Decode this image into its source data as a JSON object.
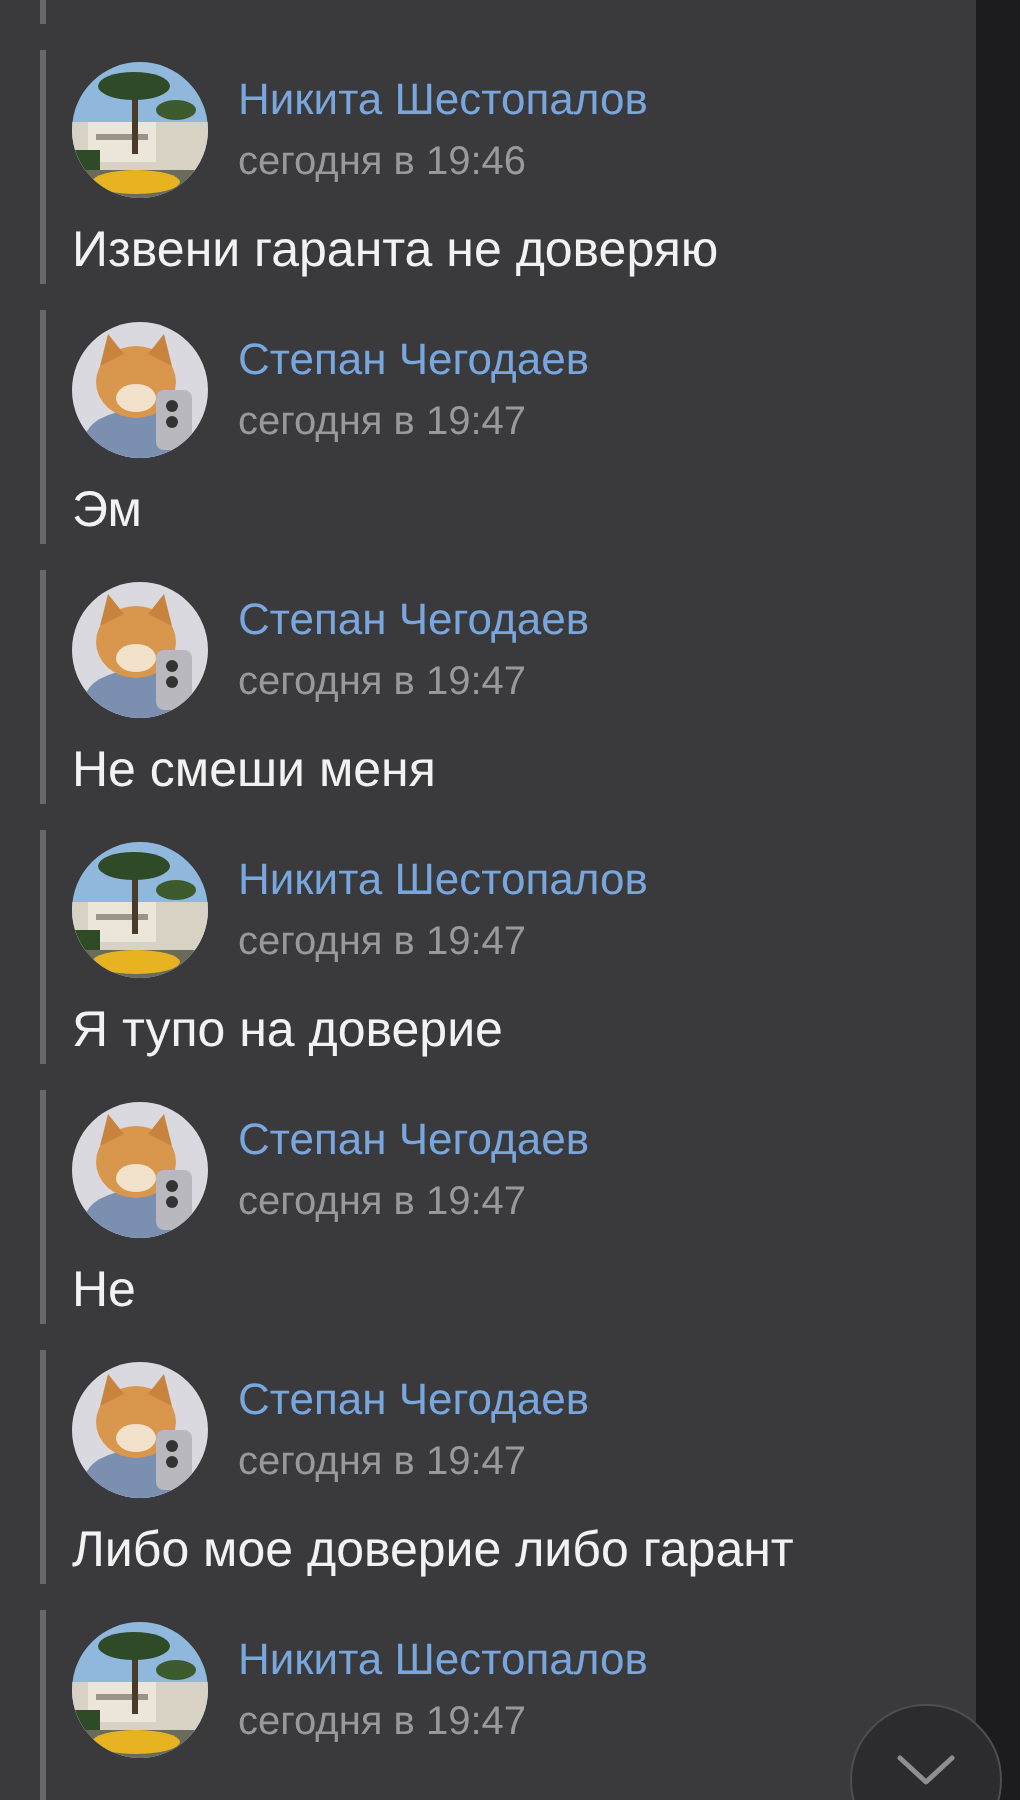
{
  "messages": [
    {
      "author": "Никита Шестопалов",
      "time": "сегодня в 19:46",
      "text": "Извени гаранта не доверяю"
    },
    {
      "author": "Степан Чегодаев",
      "time": "сегодня в 19:47",
      "text": "Эм"
    },
    {
      "author": "Степан Чегодаев",
      "time": "сегодня в 19:47",
      "text": "Не смеши меня"
    },
    {
      "author": "Никита Шестопалов",
      "time": "сегодня в 19:47",
      "text": "Я тупо на доверие"
    },
    {
      "author": "Степан Чегодаев",
      "time": "сегодня в 19:47",
      "text": "Не"
    },
    {
      "author": "Степан Чегодаев",
      "time": "сегодня в 19:47",
      "text": "Либо мое доверие либо гарант"
    },
    {
      "author": "Никита Шестопалов",
      "time": "сегодня в 19:47"
    }
  ]
}
